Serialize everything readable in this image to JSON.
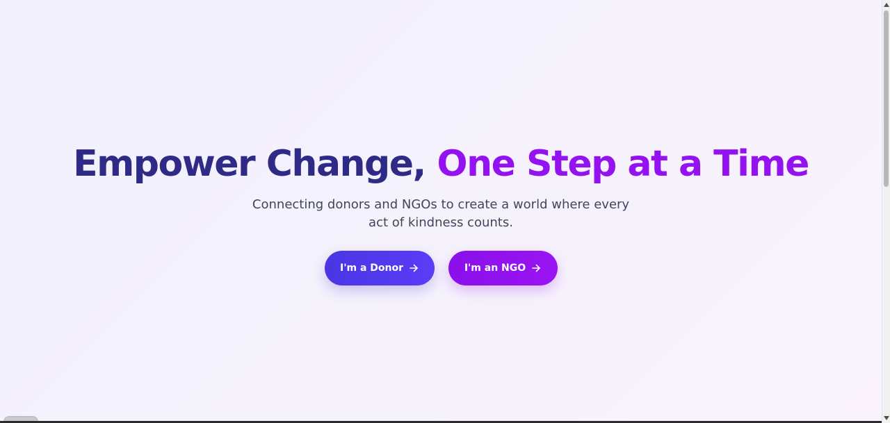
{
  "hero": {
    "headline_part_a": "Empower Change, ",
    "headline_part_b": "One Step at a Time",
    "subtitle": "Connecting donors and NGOs to create a world where every act of kindness counts.",
    "donor_button_label": "I'm a Donor",
    "ngo_button_label": "I'm an NGO"
  },
  "icons": {
    "button_arrow": "arrow-right-icon",
    "scroll_up": "triangle-up-icon",
    "scroll_down": "triangle-down-icon"
  },
  "colors": {
    "headline_primary": "#2f2a85",
    "headline_accent": "#9412ef",
    "donor_button": "#4f38ea",
    "ngo_button": "#9012ee",
    "subtitle_text": "#40455a"
  }
}
